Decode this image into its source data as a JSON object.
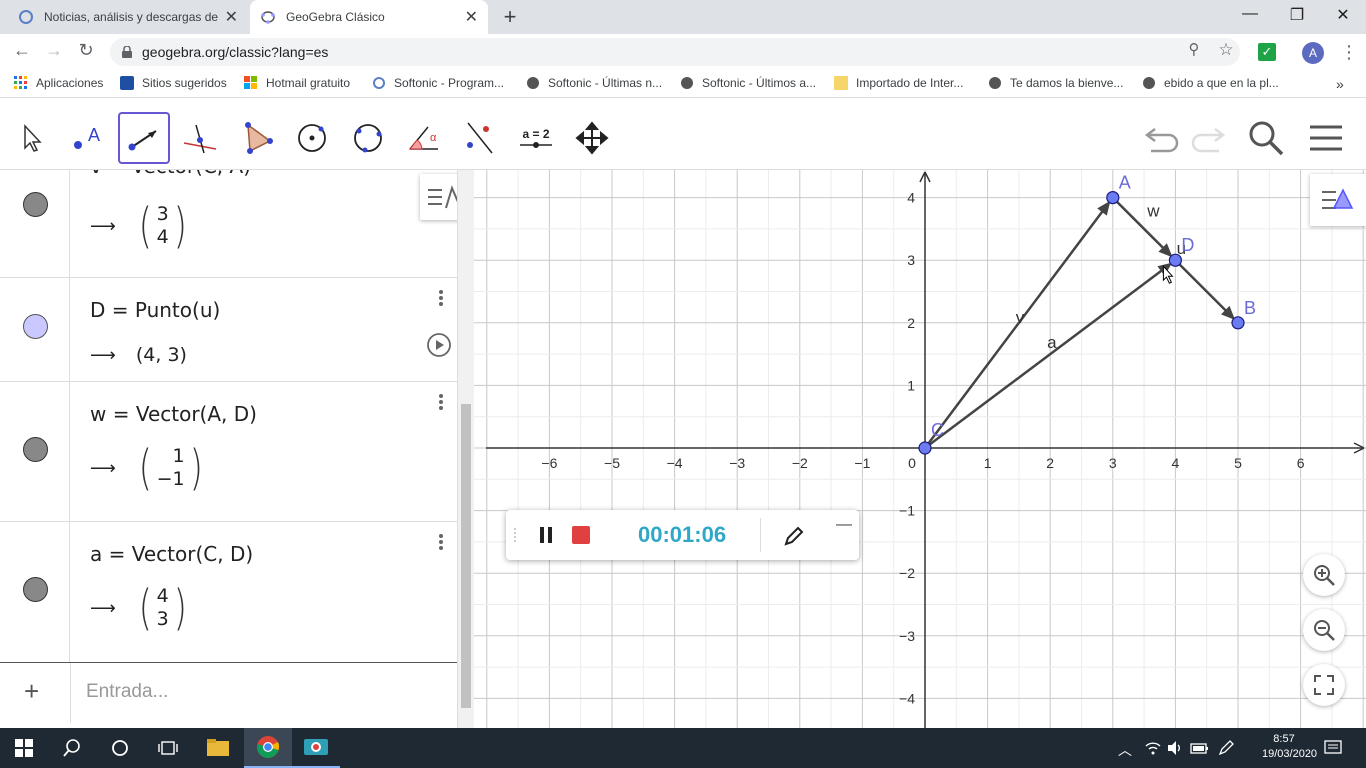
{
  "browser": {
    "tabs": [
      {
        "title": "Noticias, análisis y descargas de ",
        "active": false
      },
      {
        "title": "GeoGebra Clásico",
        "active": true
      }
    ],
    "url": "geogebra.org/classic?lang=es",
    "profile_initial": "A",
    "bookmarks": [
      "Aplicaciones",
      "Sitios sugeridos",
      "Hotmail gratuito",
      "Softonic - Program...",
      "Softonic - Últimas n...",
      "Softonic - Últimos a...",
      "Importado de Inter...",
      "Te damos la bienve...",
      "ebido a que en la pl..."
    ]
  },
  "toolbar": {
    "number_tool_label": "a = 2",
    "active_tool": "vector"
  },
  "algebra": {
    "rows": [
      {
        "definition": "v = Vector(C, A)",
        "result_prefix": "",
        "matrix": [
          "3",
          "4"
        ],
        "color": "#888888"
      },
      {
        "definition": "D = Punto(u)",
        "result": "(4,  3)",
        "color": "#c9c9ff"
      },
      {
        "definition": "w = Vector(A, D)",
        "matrix": [
          "1",
          "−1"
        ],
        "color": "#888888"
      },
      {
        "definition": "a = Vector(C, D)",
        "matrix": [
          "4",
          "3"
        ],
        "color": "#888888"
      }
    ],
    "input_placeholder": "Entrada..."
  },
  "graphics": {
    "x_ticks": [
      "−6",
      "−5",
      "−4",
      "−3",
      "−2",
      "−1",
      "0",
      "1",
      "2",
      "3",
      "4",
      "5",
      "6"
    ],
    "y_ticks": [
      "4",
      "3",
      "2",
      "1",
      "−1",
      "−2",
      "−3",
      "−4"
    ],
    "points": [
      {
        "label": "A",
        "x": 3,
        "y": 4
      },
      {
        "label": "D",
        "x": 4,
        "y": 3
      },
      {
        "label": "B",
        "x": 5,
        "y": 2
      },
      {
        "label": "C",
        "x": 0,
        "y": 0
      }
    ],
    "vector_labels": {
      "v": "v",
      "w": "w",
      "a": "a",
      "u": "u"
    }
  },
  "recorder": {
    "time": "00:01:06"
  },
  "taskbar": {
    "time": "8:57",
    "date": "19/03/2020"
  }
}
